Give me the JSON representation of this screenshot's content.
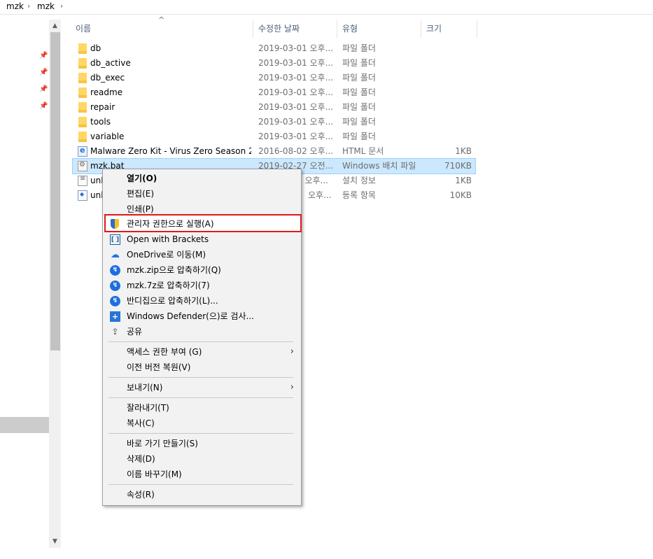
{
  "breadcrumb": {
    "items": [
      "mzk",
      "mzk"
    ]
  },
  "columns": {
    "name": "이름",
    "date": "수정한 날짜",
    "type": "유형",
    "size": "크기"
  },
  "files": [
    {
      "name": "db",
      "date": "2019-03-01 오후...",
      "type": "파일 폴더",
      "size": "",
      "icon": "folder-icon"
    },
    {
      "name": "db_active",
      "date": "2019-03-01 오후...",
      "type": "파일 폴더",
      "size": "",
      "icon": "folder-icon"
    },
    {
      "name": "db_exec",
      "date": "2019-03-01 오후...",
      "type": "파일 폴더",
      "size": "",
      "icon": "folder-icon"
    },
    {
      "name": "readme",
      "date": "2019-03-01 오후...",
      "type": "파일 폴더",
      "size": "",
      "icon": "folder-icon"
    },
    {
      "name": "repair",
      "date": "2019-03-01 오후...",
      "type": "파일 폴더",
      "size": "",
      "icon": "folder-icon"
    },
    {
      "name": "tools",
      "date": "2019-03-01 오후...",
      "type": "파일 폴더",
      "size": "",
      "icon": "folder-icon"
    },
    {
      "name": "variable",
      "date": "2019-03-01 오후...",
      "type": "파일 폴더",
      "size": "",
      "icon": "folder-icon"
    },
    {
      "name": "Malware Zero Kit - Virus Zero Season 2....",
      "date": "2016-08-02 오후...",
      "type": "HTML 문서",
      "size": "1KB",
      "icon": "html-file-icon"
    },
    {
      "name": "mzk.bat",
      "date": "2019-02-27 오전...",
      "type": "Windows 배치 파일",
      "size": "710KB",
      "icon": "batch-file-icon"
    },
    {
      "name": "unl",
      "date": "9 오후...",
      "type": "설치 정보",
      "size": "1KB",
      "icon": "setup-info-icon"
    },
    {
      "name": "unl",
      "date": "오후...",
      "type": "등록 항목",
      "size": "10KB",
      "icon": "registry-file-icon"
    }
  ],
  "context_menu": {
    "open": "열기(O)",
    "edit": "편집(E)",
    "print": "인쇄(P)",
    "run_as_admin": "관리자 권한으로 실행(A)",
    "open_brackets": "Open with Brackets",
    "onedrive": "OneDrive로 이동(M)",
    "zip": "mzk.zip으로 압축하기(Q)",
    "sevenz": "mzk.7z로 압축하기(7)",
    "bandizip": "반디집으로 압축하기(L)...",
    "defender": "Windows Defender(으)로 검사...",
    "share": "공유",
    "give_access": "액세스 권한 부여 (G)",
    "restore": "이전 버전 복원(V)",
    "send_to": "보내기(N)",
    "cut": "잘라내기(T)",
    "copy": "복사(C)",
    "shortcut": "바로 가기 만들기(S)",
    "delete": "삭제(D)",
    "rename": "이름 바꾸기(M)",
    "properties": "속성(R)"
  },
  "colors": {
    "selection": "#cce8ff",
    "highlight_border": "#e01a1a",
    "menu_bg": "#f2f2f2"
  }
}
